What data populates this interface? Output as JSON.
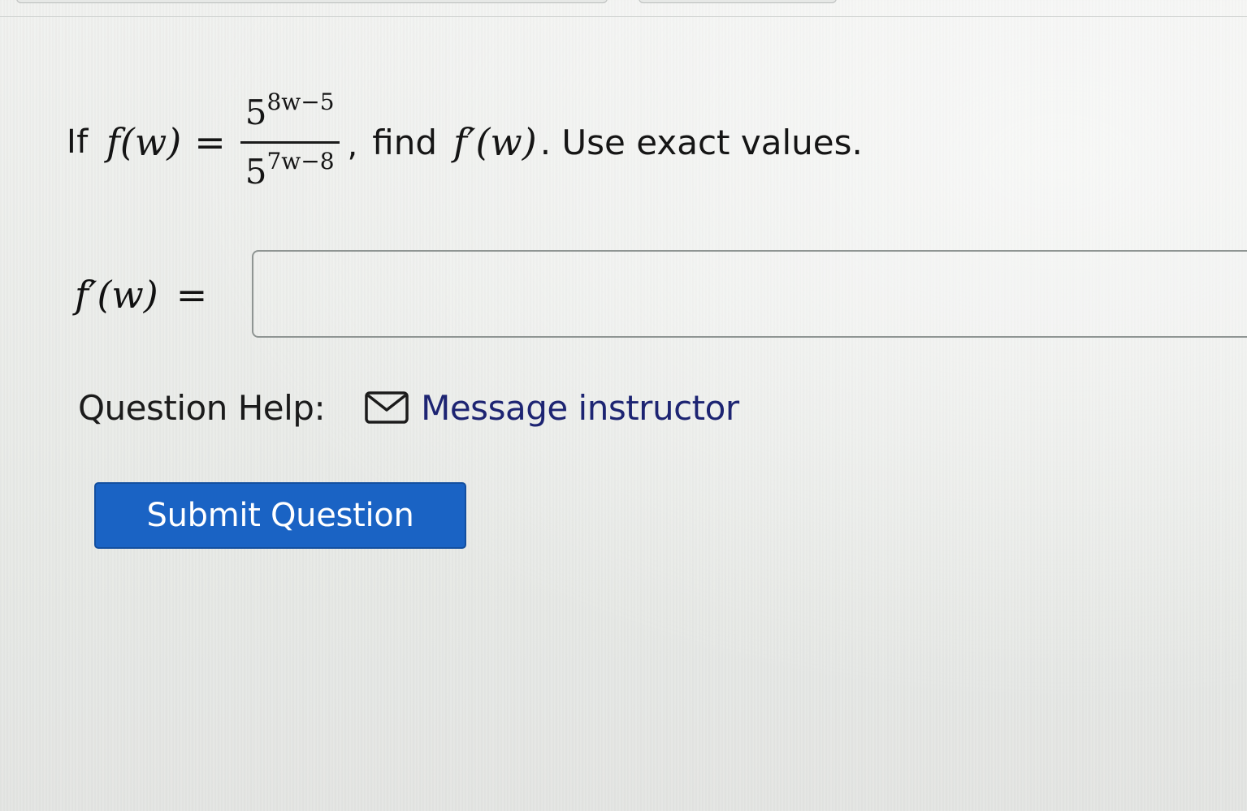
{
  "question": {
    "if_word": "If",
    "function_lhs": "f(w)",
    "equals": "=",
    "numerator_base": "5",
    "numerator_exponent": "8w−5",
    "denominator_base": "5",
    "denominator_exponent": "7w−8",
    "comma": ",",
    "find_word": "find",
    "target": "f′(w)",
    "tail": ". Use exact values."
  },
  "answer": {
    "label": "f′(w)",
    "equals": "=",
    "value": ""
  },
  "help": {
    "label": "Question Help:",
    "icon": "envelope-icon",
    "link_text": "Message instructor",
    "link_color": "#1d2472"
  },
  "submit": {
    "label": "Submit Question",
    "color": "#1a63c4"
  }
}
